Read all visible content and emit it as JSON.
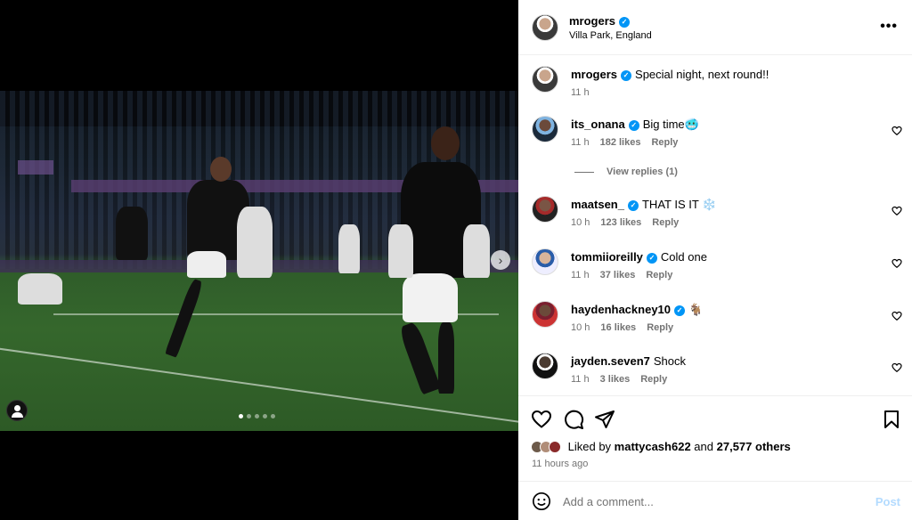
{
  "post": {
    "author": "mrogers",
    "location": "Villa Park, England",
    "caption": "Special night, next round!!",
    "caption_time": "11 h"
  },
  "comments": [
    {
      "user": "its_onana",
      "verified": true,
      "text": "Big time🥶",
      "time": "11 h",
      "likes": "182 likes",
      "reply": "Reply",
      "view_replies": "View replies (1)"
    },
    {
      "user": "maatsen_",
      "verified": true,
      "text": "THAT IS IT ❄️",
      "time": "10 h",
      "likes": "123 likes",
      "reply": "Reply"
    },
    {
      "user": "tommiioreilly",
      "verified": true,
      "text": "Cold one",
      "time": "11 h",
      "likes": "37 likes",
      "reply": "Reply"
    },
    {
      "user": "haydenhackney10",
      "verified": true,
      "text": "🐐",
      "time": "10 h",
      "likes": "16 likes",
      "reply": "Reply"
    },
    {
      "user": "jayden.seven7",
      "verified": false,
      "text": "Shock",
      "time": "11 h",
      "likes": "3 likes",
      "reply": "Reply"
    }
  ],
  "likes": {
    "prefix": "Liked by",
    "user": "mattycash622",
    "and": "and",
    "others": "27,577 others"
  },
  "time_ago": "11 hours ago",
  "comment_box": {
    "placeholder": "Add a comment...",
    "post_label": "Post"
  },
  "carousel": {
    "count": 5,
    "active_index": 0,
    "next_symbol": "›"
  },
  "more_symbol": "•••",
  "colors": {
    "verified_blue": "#0095f6",
    "secondary_text": "#737373",
    "post_button_disabled": "#b3dbff"
  }
}
